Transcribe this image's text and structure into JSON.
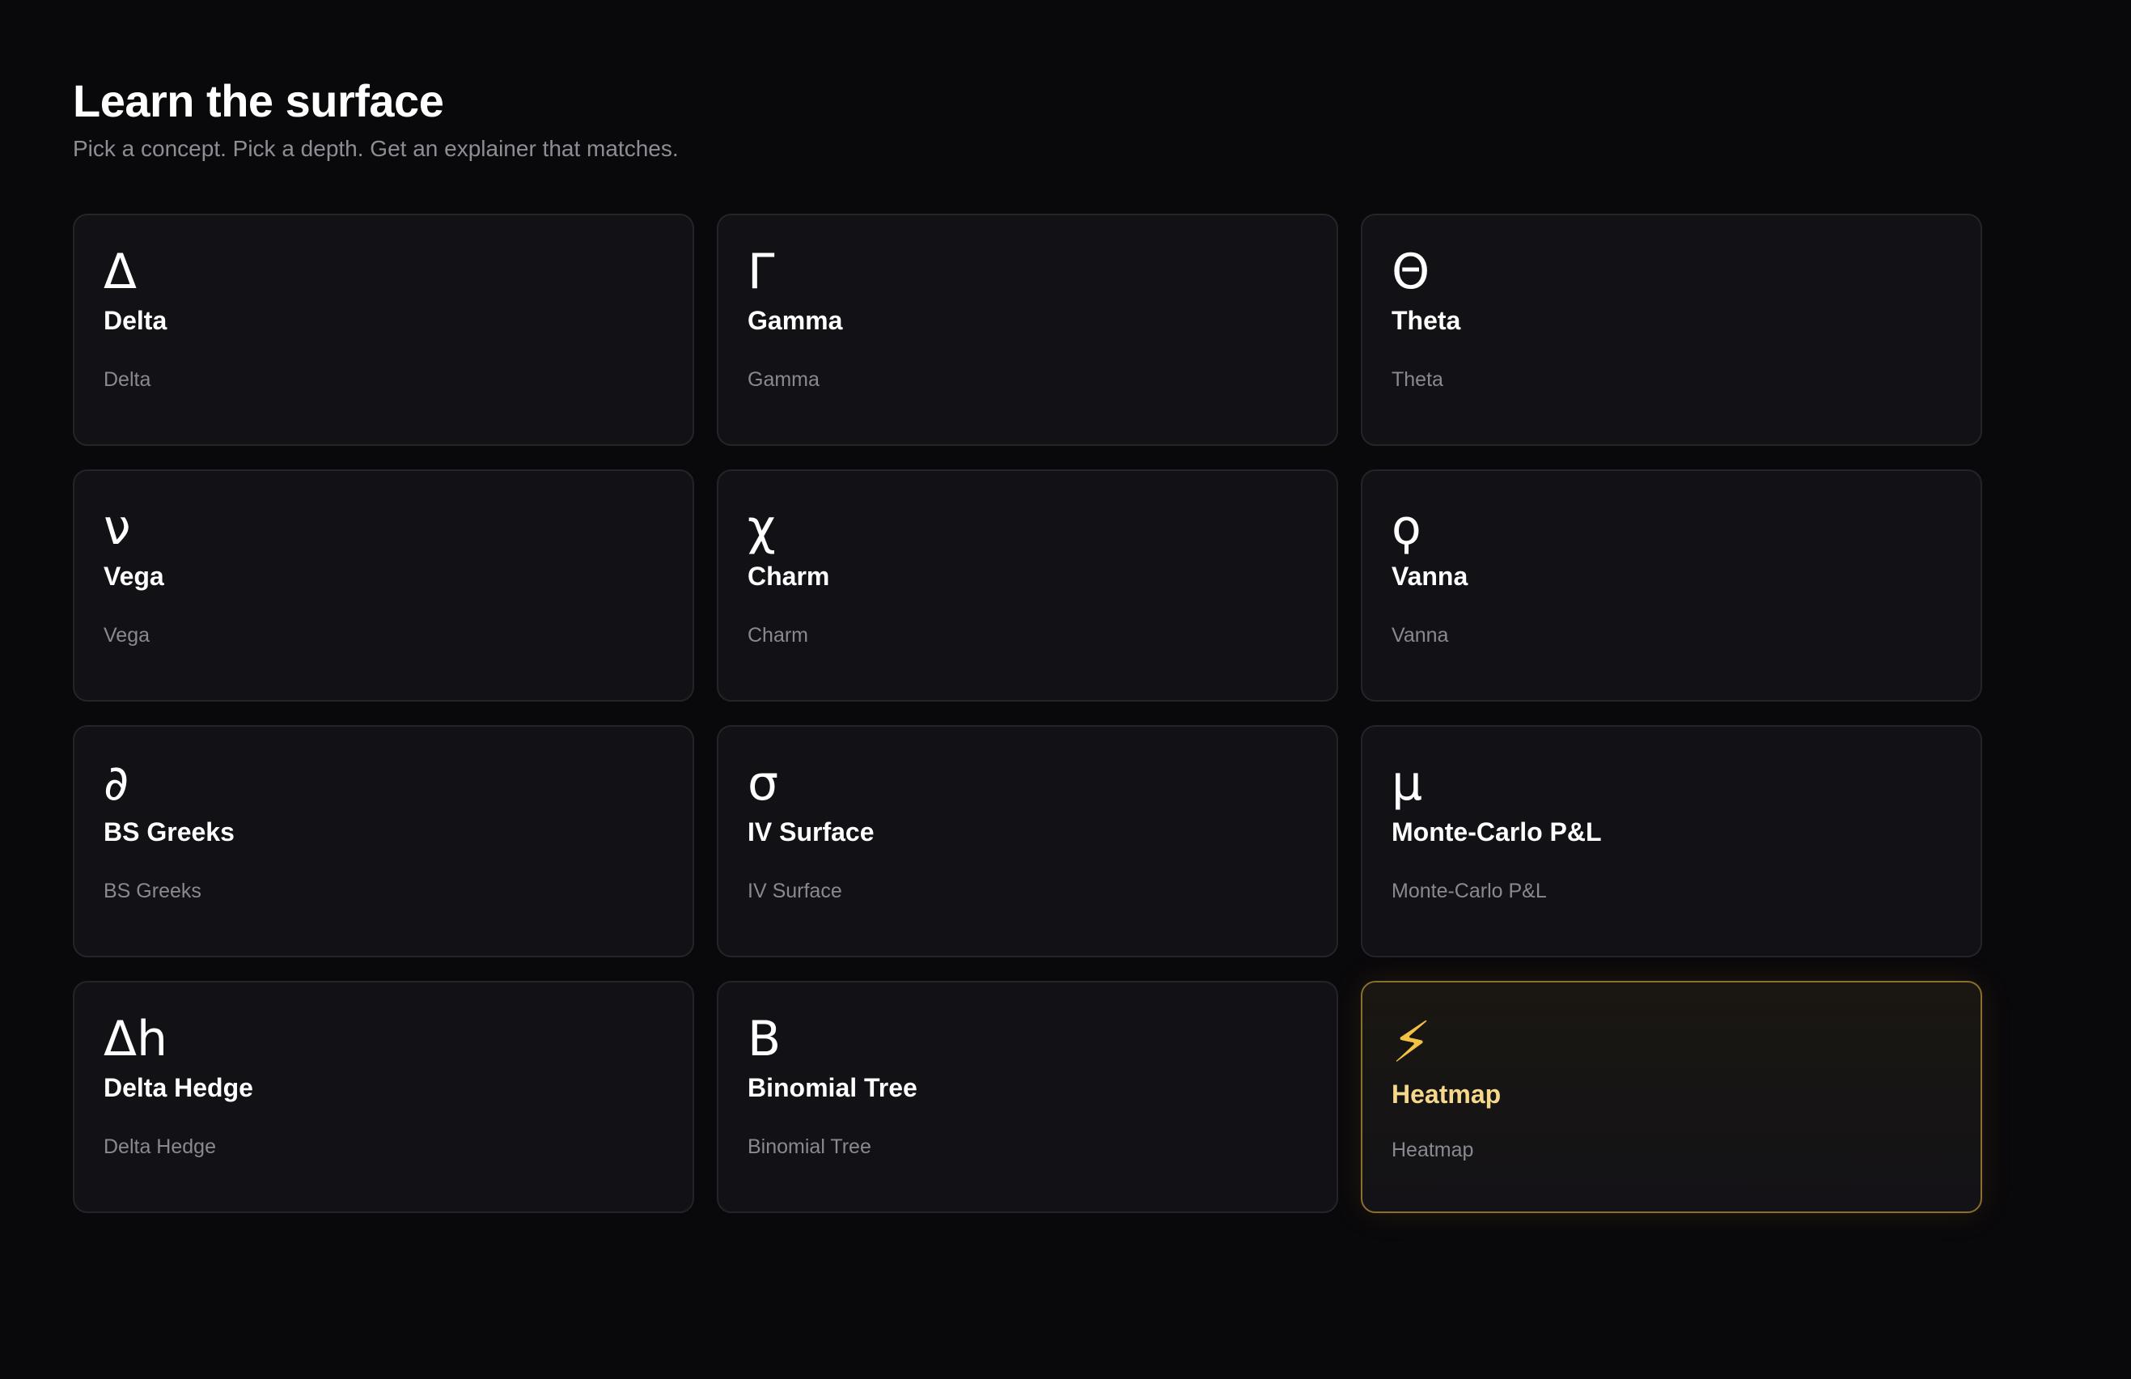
{
  "header": {
    "title": "Learn the surface",
    "subtitle": "Pick a concept. Pick a depth. Get an explainer that matches."
  },
  "colors": {
    "background": "#09080b",
    "card": "#121116",
    "card_border": "#25242b",
    "accent": "#f3c244"
  },
  "cards": [
    {
      "glyph": "Δ",
      "name": "Delta",
      "desc": "Delta"
    },
    {
      "glyph": "Γ",
      "name": "Gamma",
      "desc": "Gamma"
    },
    {
      "glyph": "Θ",
      "name": "Theta",
      "desc": "Theta"
    },
    {
      "glyph": "ν",
      "name": "Vega",
      "desc": "Vega"
    },
    {
      "glyph": "χ",
      "name": "Charm",
      "desc": "Charm"
    },
    {
      "glyph": "ϙ",
      "name": "Vanna",
      "desc": "Vanna"
    },
    {
      "glyph": "∂",
      "name": "BS Greeks",
      "desc": "BS Greeks"
    },
    {
      "glyph": "σ",
      "name": "IV Surface",
      "desc": "IV Surface"
    },
    {
      "glyph": "μ",
      "name": "Monte-Carlo P&L",
      "desc": "Monte-Carlo P&L"
    },
    {
      "glyph": "Δh",
      "name": "Delta Hedge",
      "desc": "Delta Hedge"
    },
    {
      "glyph": "B",
      "name": "Binomial Tree",
      "desc": "Binomial Tree"
    },
    {
      "glyph": "⚡",
      "name": "Heatmap",
      "desc": "Heatmap",
      "icon": "lightning-bolt-icon",
      "featured": true
    }
  ]
}
